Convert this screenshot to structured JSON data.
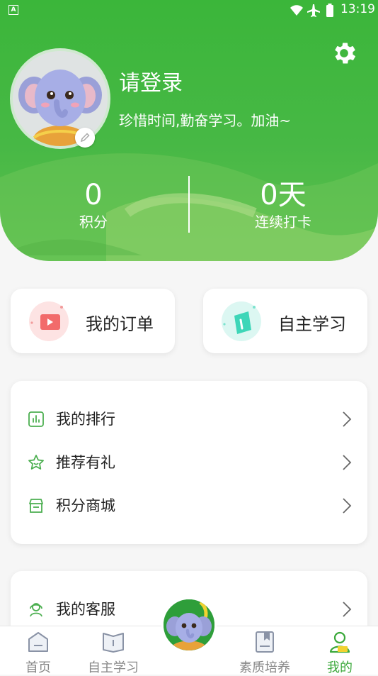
{
  "status_bar": {
    "time": "13:19",
    "notification_letter": "A",
    "icons": [
      "wifi-icon",
      "airplane-icon",
      "battery-icon"
    ]
  },
  "header": {
    "login_text": "请登录",
    "slogan": "珍惜时间,勤奋学习。加油~",
    "stats": [
      {
        "value": "0",
        "label": "积分"
      },
      {
        "value": "0天",
        "label": "连续打卡"
      }
    ],
    "settings_icon": "gear-icon",
    "accent_color": "#3bb63a"
  },
  "quick_actions": [
    {
      "label": "我的订单",
      "icon": "video-order-icon"
    },
    {
      "label": "自主学习",
      "icon": "self-study-icon"
    }
  ],
  "menu_group_1": [
    {
      "label": "我的排行",
      "icon": "ranking-chart-icon"
    },
    {
      "label": "推荐有礼",
      "icon": "star-gift-icon"
    },
    {
      "label": "积分商城",
      "icon": "store-icon"
    }
  ],
  "menu_group_2": [
    {
      "label": "我的客服",
      "icon": "customer-service-icon"
    }
  ],
  "tabs": [
    {
      "label": "首页",
      "icon": "home-icon",
      "active": false
    },
    {
      "label": "自主学习",
      "icon": "book-icon",
      "active": false
    },
    {
      "label": "素质培养",
      "icon": "quality-book-icon",
      "active": false
    },
    {
      "label": "我的",
      "icon": "profile-icon",
      "active": true
    }
  ]
}
